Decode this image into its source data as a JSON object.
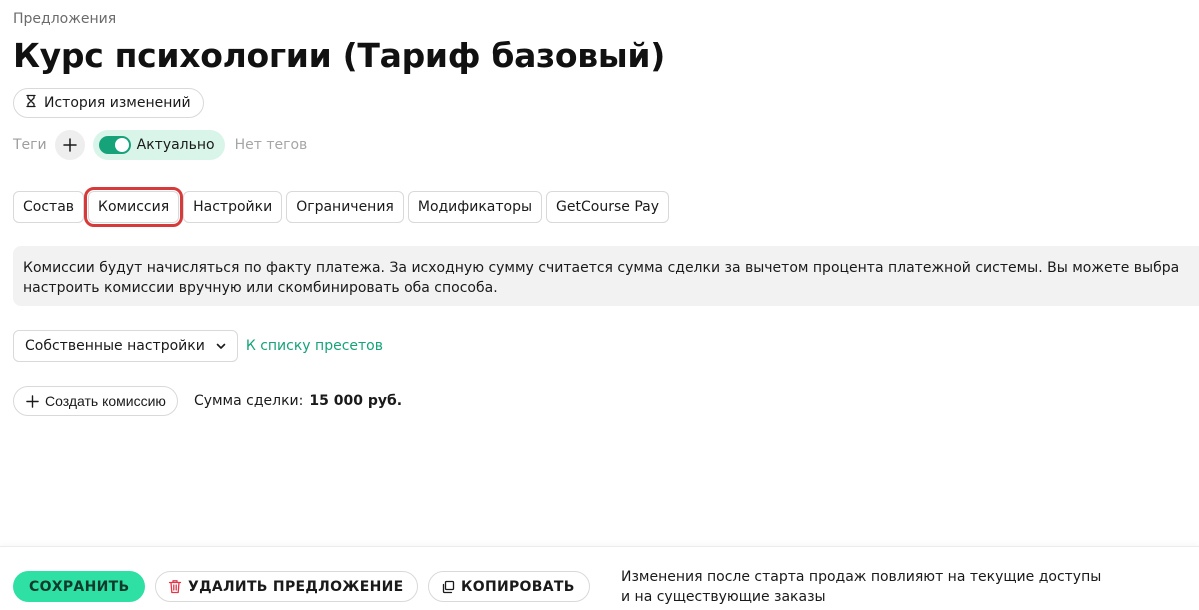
{
  "breadcrumb": "Предложения",
  "title": "Курс психологии (Тариф базовый)",
  "history_button": {
    "label": "История изменений",
    "icon": "hourglass-icon"
  },
  "tags": {
    "label": "Теги",
    "add_icon": "plus-icon",
    "status_label": "Актуально",
    "status_on": true,
    "empty_text": "Нет тегов"
  },
  "tabs": [
    {
      "label": "Состав",
      "active": false
    },
    {
      "label": "Комиссия",
      "active": true
    },
    {
      "label": "Настройки",
      "active": false
    },
    {
      "label": "Ограничения",
      "active": false
    },
    {
      "label": "Модификаторы",
      "active": false
    },
    {
      "label": "GetCourse Pay",
      "active": false
    }
  ],
  "info": {
    "line1": "Комиссии будут начисляться по факту платежа. За исходную сумму считается сумма сделки за вычетом процента платежной системы. Вы можете выбра",
    "line2": "настроить комиссии вручную или скомбинировать оба способа."
  },
  "preset": {
    "selected": "Собственные настройки",
    "link": "К списку пресетов"
  },
  "commission": {
    "create_label": "Создать комиссию",
    "deal_sum_label": "Сумма сделки:",
    "deal_sum_value": "15 000 руб."
  },
  "footer": {
    "save_label": "СОХРАНИТЬ",
    "delete_label": "УДАЛИТЬ ПРЕДЛОЖЕНИЕ",
    "copy_label": "КОПИРОВАТЬ",
    "note_line1": "Изменения после старта продаж повлияют на текущие доступы",
    "note_line2": "и на существующие заказы"
  },
  "colors": {
    "accent_green": "#2ee0a4",
    "link_green": "#16a37a",
    "toggle_green": "#16a37a",
    "status_bg": "#d9f5ea",
    "highlight_red": "#d63a3a",
    "delete_icon_red": "#e0384a"
  }
}
